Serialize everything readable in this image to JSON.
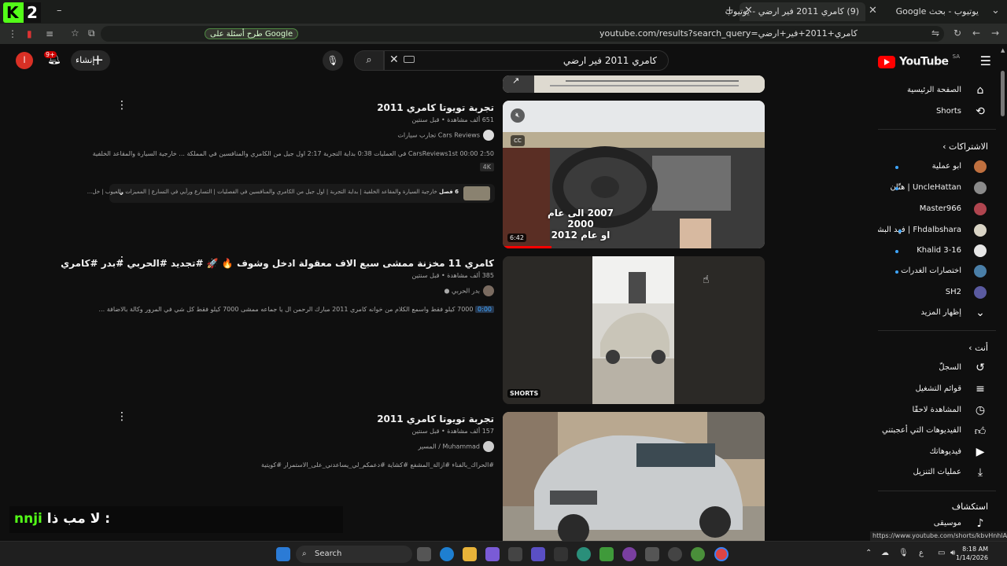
{
  "browser": {
    "logo_letter": "K",
    "logo_number": "2",
    "tabs": [
      {
        "label": "يوتيوب - بحث Google",
        "active": false
      },
      {
        "label": "(9) كامري 2011 فير ارضي - يوتيوب",
        "active": true
      }
    ],
    "url": "youtube.com/results?search_query=كامري+2011+فير+ارضي",
    "google_chip": "طرح أسئلة على Google"
  },
  "header": {
    "search_query": "كامري 2011 فير ارضي",
    "logo_word": "YouTube",
    "logo_region": "SA",
    "create_label": "إنشاء",
    "notif_count": "9+",
    "avatar_letter": "ا"
  },
  "sidebar": {
    "top": [
      {
        "label": "الصفحة الرئيسية",
        "icon": "home-icon",
        "glyph": "⌂"
      },
      {
        "label": "Shorts",
        "icon": "shorts-icon",
        "glyph": "⟲"
      }
    ],
    "subs_heading": "الاشتراكات ›",
    "subs": [
      {
        "label": "ابو عملية",
        "color": "#c0703f"
      },
      {
        "label": "UncleHattan | هتّان",
        "color": "#8a8a8a"
      },
      {
        "label": "Master966",
        "color": "#b0454f"
      },
      {
        "label": "Fhdalbshara | فهد البشاره",
        "color": "#d9d4c5"
      },
      {
        "label": "Khalid 3-16",
        "color": "#e6e6e6"
      },
      {
        "label": "اختصارات الغدرات",
        "color": "#4a7fa8"
      },
      {
        "label": "SH2",
        "color": "#5a5aa0"
      }
    ],
    "show_more": "إظهار المزيد",
    "you_heading": "أنت ›",
    "you": [
      {
        "label": "السجلّ",
        "icon": "history-icon",
        "glyph": "↺"
      },
      {
        "label": "قوائم التشغيل",
        "icon": "playlists-icon",
        "glyph": "≡"
      },
      {
        "label": "المشاهدة لاحقًا",
        "icon": "watch-later-icon",
        "glyph": "◷"
      },
      {
        "label": "الفيديوهات التي أعجبتني",
        "icon": "like-icon",
        "glyph": "👍"
      },
      {
        "label": "فيديوهاتك",
        "icon": "your-videos-icon",
        "glyph": "▶"
      },
      {
        "label": "عمليات التنزيل",
        "icon": "download-icon",
        "glyph": "⤓"
      }
    ],
    "explore_heading": "استكشاف",
    "explore": [
      {
        "label": "موسيقى",
        "icon": "music-icon",
        "glyph": "♪"
      }
    ]
  },
  "results": [
    {
      "title": "تجربة تويوتا كامري 2011",
      "meta": "651 ألف مشاهدة • قبل سنتين",
      "channel": "Cars Reviews تجارب سيارات",
      "desc": "CarsReviews1st 00:00 2:50 في العمليات 0:38 بداية التجربة 2:17 اول جيل من الكامري والمنافسين في المملكة ... خارجية السيارة والمقاعد الخلفية",
      "badge": "4K",
      "duration": "6:42",
      "caption_line1": "2007 الى عام 2000",
      "caption_line2": "او عام 2012",
      "chapters_count": "6 فصل",
      "chapters_text": "خارجية السيارة والمقاعد الخلفية | بداية التجربة | اول جيل من الكامري والمنافسين في الفصليات | التسارع ورأيي في التسارع | المميزات والعيوب | خل..."
    },
    {
      "title": "كامري 11 مخزنة ممشى سبع الاف معقولة ادخل وشوف 🔥 🚀 #تجديد #الحربي #بدر #كامري",
      "meta": "385 ألف مشاهدة • قبل سنتين",
      "channel": "بدر الحربي",
      "timestamp": "0:00",
      "desc": "7000 كيلو فقط واسمع الكلام من خوانه كامري 2011 مبارك الرحمن ال يا جماعه ممشى 7000 كيلو فقط كل شي في المرور وكالة بالاضافة ...",
      "shorts_label": "SHORTS"
    },
    {
      "title": "تجربة تويوتا كامري 2011",
      "meta": "157 ألف مشاهدة • قبل سنتين",
      "channel": "Muhammad / المسير",
      "desc": "#الحراك_بالفناء #ازالة_المشفع #كشاية #دعمكم_لي_يساعدني_على_الاستمرار #كويتية"
    }
  ],
  "overlay_subtitle": {
    "green": "nnji",
    "white": "لا مب ذا :"
  },
  "status_url": "https://www.youtube.com/shorts/kbvHnhlAxpU",
  "taskbar": {
    "search_label": "Search",
    "time": "8:18 AM",
    "date": "1/14/2026",
    "lang": "ع"
  }
}
